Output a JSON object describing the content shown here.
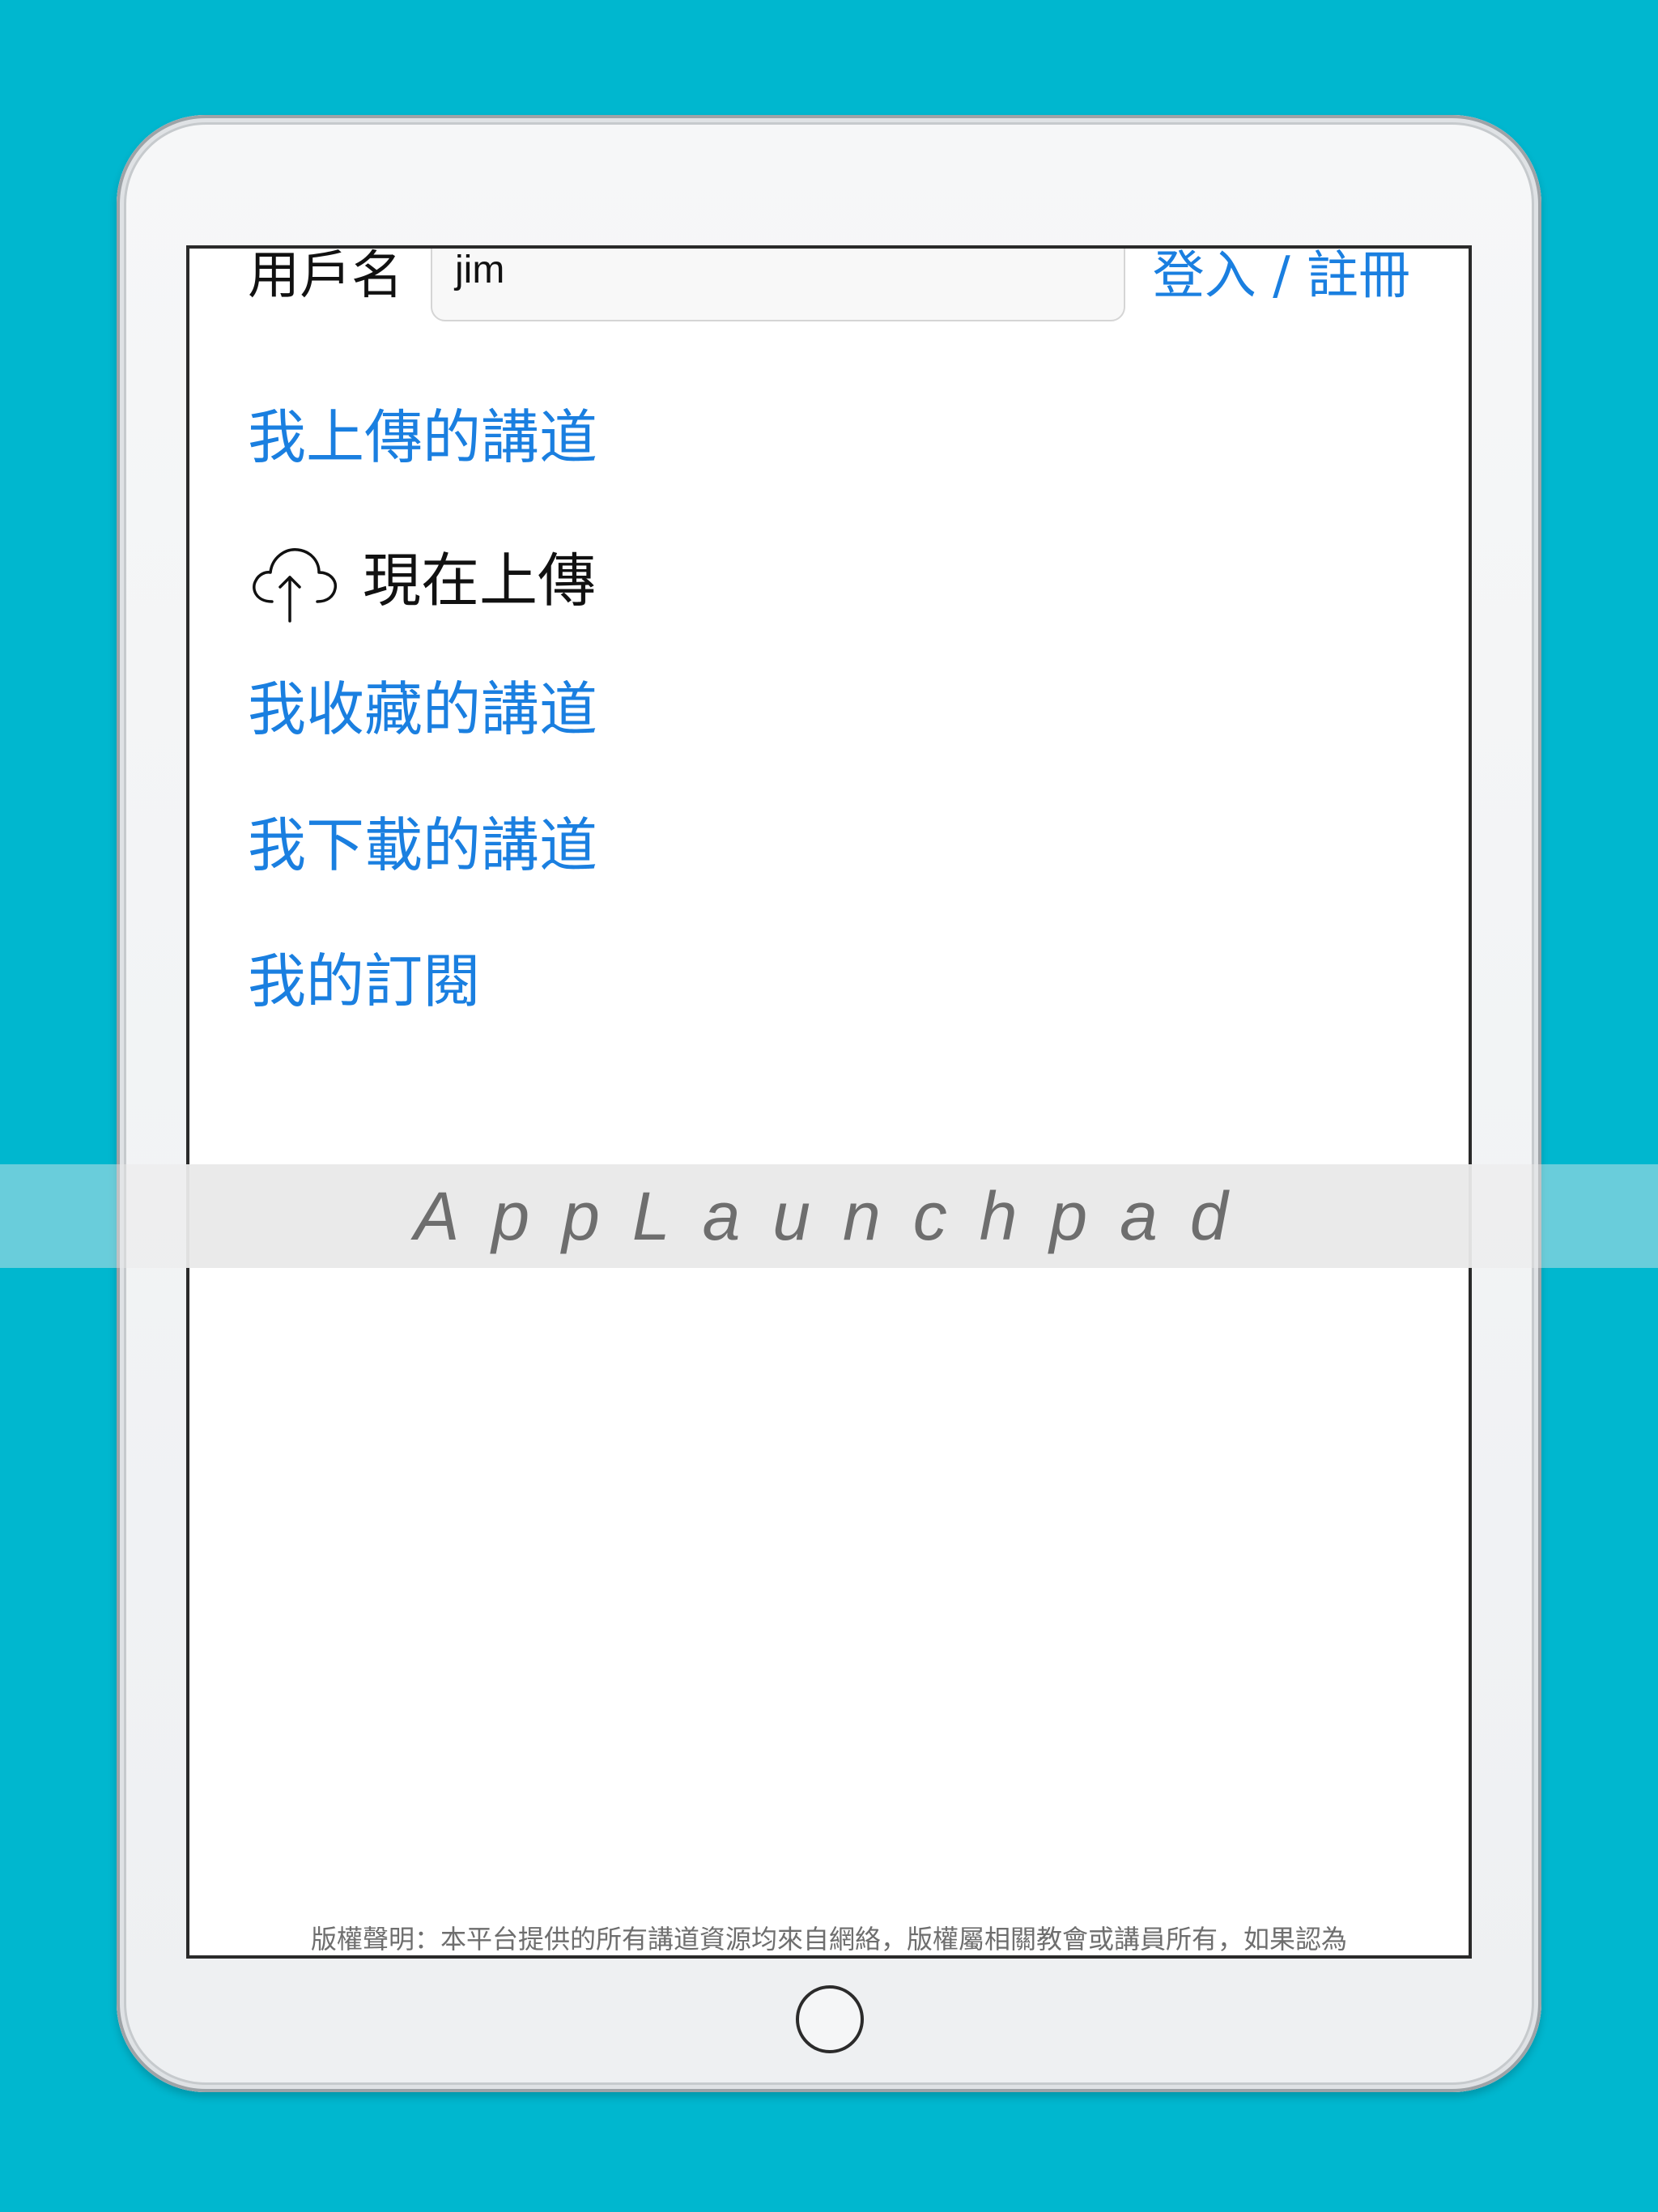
{
  "login": {
    "username_label": "用戶名",
    "username_value": "jim",
    "login_link": "登入 / 註冊"
  },
  "menu": {
    "my_uploads": "我上傳的講道",
    "upload_now": "現在上傳",
    "my_favorites": "我收藏的講道",
    "my_downloads": "我下載的講道",
    "my_subscriptions": "我的訂閱"
  },
  "footer": {
    "copyright": "版權聲明：本平台提供的所有講道資源均來自網絡，版權屬相關教會或講員所有，如果認為"
  },
  "watermark": {
    "text": "AppLaunchpad"
  },
  "icons": {
    "upload": "cloud-upload-icon"
  },
  "colors": {
    "background": "#00b7cf",
    "link": "#1a7fe0"
  }
}
